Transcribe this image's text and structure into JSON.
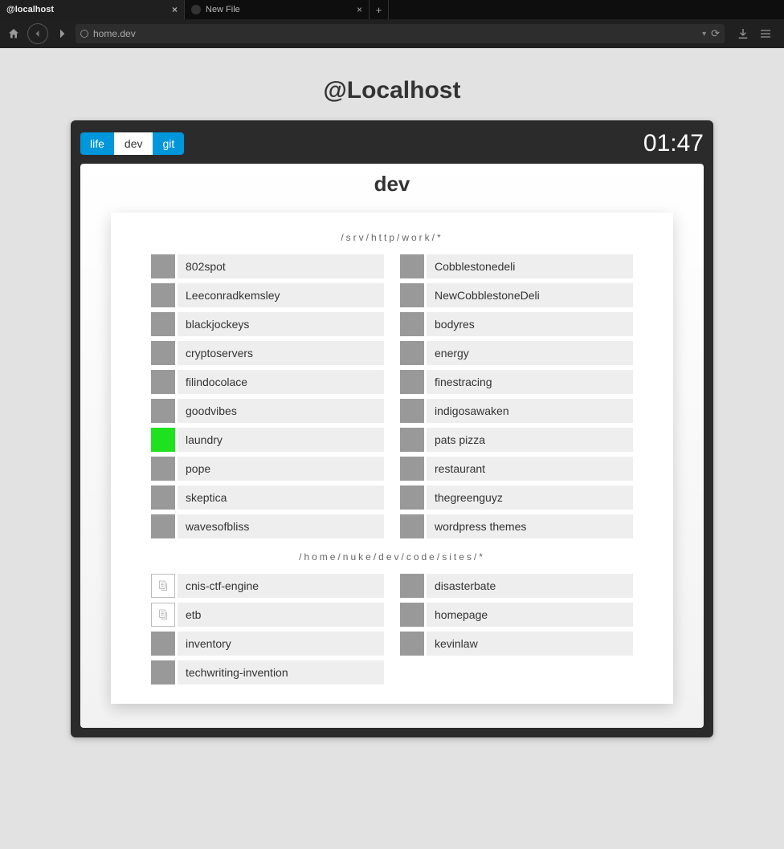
{
  "browser": {
    "tabs": [
      {
        "label": "@localhost",
        "active": true
      },
      {
        "label": "New File",
        "active": false
      }
    ],
    "url": "home.dev"
  },
  "page": {
    "title": "@Localhost",
    "clock": "01:47",
    "nav_tabs": [
      {
        "id": "life",
        "label": "life",
        "active": false
      },
      {
        "id": "dev",
        "label": "dev",
        "active": true
      },
      {
        "id": "git",
        "label": "git",
        "active": false
      }
    ],
    "section_title": "dev",
    "groups": [
      {
        "path": "/srv/http/work/*",
        "left": [
          {
            "label": "802spot",
            "swatch": "gray"
          },
          {
            "label": "Leeconradkemsley",
            "swatch": "gray"
          },
          {
            "label": "blackjockeys",
            "swatch": "gray"
          },
          {
            "label": "cryptoservers",
            "swatch": "gray"
          },
          {
            "label": "filindocolace",
            "swatch": "gray"
          },
          {
            "label": "goodvibes",
            "swatch": "gray"
          },
          {
            "label": "laundry",
            "swatch": "green"
          },
          {
            "label": "pope",
            "swatch": "gray"
          },
          {
            "label": "skeptica",
            "swatch": "gray"
          },
          {
            "label": "wavesofbliss",
            "swatch": "gray"
          }
        ],
        "right": [
          {
            "label": "Cobblestonedeli",
            "swatch": "gray"
          },
          {
            "label": "NewCobblestoneDeli",
            "swatch": "gray"
          },
          {
            "label": "bodyres",
            "swatch": "gray"
          },
          {
            "label": "energy",
            "swatch": "gray"
          },
          {
            "label": "finestracing",
            "swatch": "gray"
          },
          {
            "label": "indigosawaken",
            "swatch": "gray"
          },
          {
            "label": "pats pizza",
            "swatch": "gray"
          },
          {
            "label": "restaurant",
            "swatch": "gray"
          },
          {
            "label": "thegreenguyz",
            "swatch": "gray"
          },
          {
            "label": "wordpress themes",
            "swatch": "gray"
          }
        ]
      },
      {
        "path": "/home/nuke/dev/code/sites/*",
        "left": [
          {
            "label": "cnis-ctf-engine",
            "swatch": "outline"
          },
          {
            "label": "etb",
            "swatch": "outline"
          },
          {
            "label": "inventory",
            "swatch": "gray"
          },
          {
            "label": "techwriting-invention",
            "swatch": "gray"
          }
        ],
        "right": [
          {
            "label": "disasterbate",
            "swatch": "gray"
          },
          {
            "label": "homepage",
            "swatch": "gray"
          },
          {
            "label": "kevinlaw",
            "swatch": "gray"
          }
        ]
      }
    ]
  }
}
